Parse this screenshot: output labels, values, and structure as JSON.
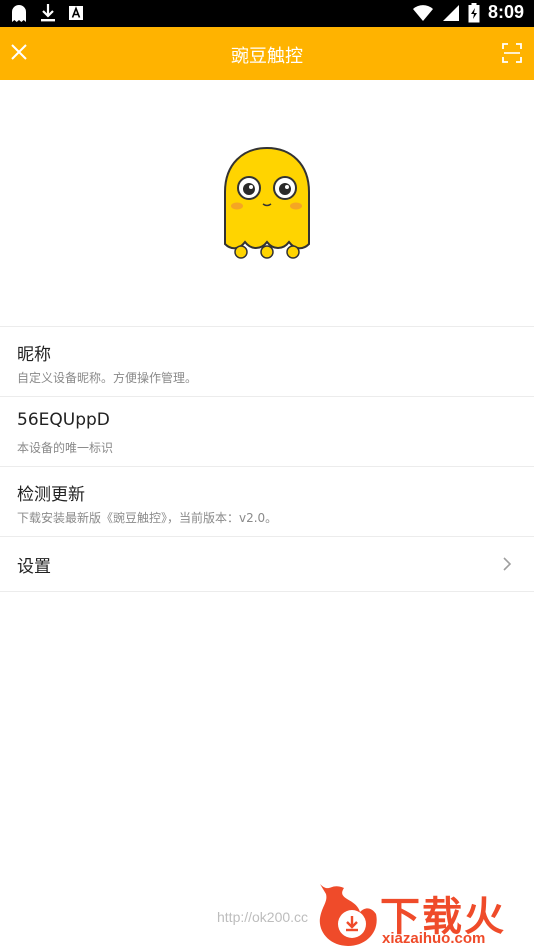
{
  "status_bar": {
    "time": "8:09",
    "left_icons": [
      "ghost-icon",
      "download-icon",
      "font-icon"
    ],
    "right_icons": [
      "wifi-icon",
      "signal-icon",
      "battery-charging-icon"
    ]
  },
  "app_bar": {
    "title": "豌豆触控",
    "left_icon": "close-icon",
    "right_icon": "scan-icon",
    "color": "#FFB300"
  },
  "items": [
    {
      "title": "昵称",
      "desc": "自定义设备昵称。方便操作管理。"
    },
    {
      "title": "56EQUppD",
      "desc": "本设备的唯一标识"
    },
    {
      "title": "检测更新",
      "desc": "下载安装最新版《豌豆触控》，当前版本：v2.0。"
    },
    {
      "title": "设置",
      "desc": ""
    }
  ],
  "footer": {
    "url": "http://ok200.cc",
    "watermark_brand": "下载火",
    "watermark_domain": "xiazaihuo.com"
  }
}
